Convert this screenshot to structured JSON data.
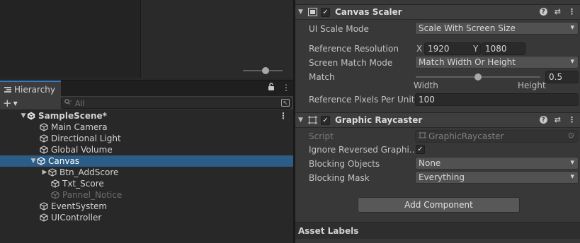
{
  "hierarchy": {
    "tab_label": "Hierarchy",
    "add_symbol": "+",
    "search_placeholder": "All",
    "scene_name": "SampleScene*",
    "items": [
      {
        "label": "Main Camera"
      },
      {
        "label": "Directional Light"
      },
      {
        "label": "Global Volume"
      },
      {
        "label": "Canvas"
      },
      {
        "label": "Btn_AddScore"
      },
      {
        "label": "Txt_Score"
      },
      {
        "label": "Pannel_Notice"
      },
      {
        "label": "EventSystem"
      },
      {
        "label": "UIController"
      }
    ]
  },
  "canvas_scaler": {
    "title": "Canvas Scaler",
    "ui_scale_mode_label": "UI Scale Mode",
    "ui_scale_mode_value": "Scale With Screen Size",
    "reference_resolution_label": "Reference Resolution",
    "x_label": "X",
    "x_value": "1920",
    "y_label": "Y",
    "y_value": "1080",
    "screen_match_mode_label": "Screen Match Mode",
    "screen_match_mode_value": "Match Width Or Height",
    "match_label": "Match",
    "match_value": "0.5",
    "width_label": "Width",
    "height_label": "Height",
    "ref_ppu_label": "Reference Pixels Per Unit",
    "ref_ppu_value": "100"
  },
  "graphic_raycaster": {
    "title": "Graphic Raycaster",
    "script_label": "Script",
    "script_value": "GraphicRaycaster",
    "ignore_reversed_label": "Ignore Reversed Graphi…",
    "blocking_objects_label": "Blocking Objects",
    "blocking_objects_value": "None",
    "blocking_mask_label": "Blocking Mask",
    "blocking_mask_value": "Everything"
  },
  "add_component_label": "Add Component",
  "asset_labels_title": "Asset Labels",
  "icons": {
    "check": "✓",
    "kebab": "⋮",
    "lock": "🔓",
    "help": "?",
    "presets": "⇄",
    "fold_open": "▼",
    "fold_closed": "▶"
  },
  "colors": {
    "selection": "#2c5d87",
    "accent": "#3a79bb"
  }
}
